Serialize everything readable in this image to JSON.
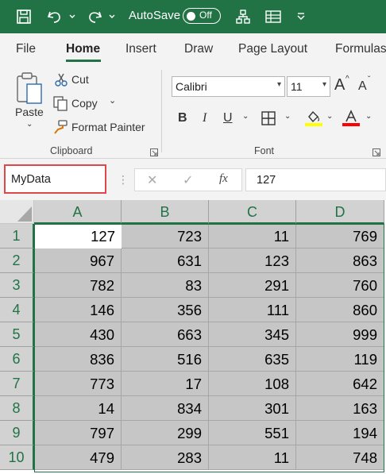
{
  "titlebar": {
    "autosave_label": "AutoSave",
    "autosave_state": "Off",
    "icons": [
      "save-icon",
      "undo-icon",
      "redo-icon",
      "hierarchy-icon",
      "form-icon",
      "customize-dropdown-icon"
    ]
  },
  "tabs": [
    {
      "label": "File"
    },
    {
      "label": "Home"
    },
    {
      "label": "Insert"
    },
    {
      "label": "Draw"
    },
    {
      "label": "Page Layout"
    },
    {
      "label": "Formulas"
    }
  ],
  "active_tab": "Home",
  "clipboard": {
    "paste_label": "Paste",
    "cut_label": "Cut",
    "copy_label": "Copy",
    "format_painter_label": "Format Painter",
    "group_label": "Clipboard"
  },
  "font": {
    "family": "Calibri",
    "size": "11",
    "grow_label": "A",
    "shrink_label": "A",
    "bold_label": "B",
    "italic_label": "I",
    "underline_label": "U",
    "group_label": "Font",
    "fill_color": "#ffff00",
    "font_color": "#ff0000"
  },
  "formula_bar": {
    "name_box": "MyData",
    "cancel_glyph": "✕",
    "enter_glyph": "✓",
    "fx_label": "fx",
    "value": "127"
  },
  "sheet": {
    "columns": [
      "A",
      "B",
      "C",
      "D"
    ],
    "rows": [
      {
        "num": "1",
        "cells": [
          "127",
          "723",
          "11",
          "769"
        ]
      },
      {
        "num": "2",
        "cells": [
          "967",
          "631",
          "123",
          "863"
        ]
      },
      {
        "num": "3",
        "cells": [
          "782",
          "83",
          "291",
          "760"
        ]
      },
      {
        "num": "4",
        "cells": [
          "146",
          "356",
          "111",
          "860"
        ]
      },
      {
        "num": "5",
        "cells": [
          "430",
          "663",
          "345",
          "999"
        ]
      },
      {
        "num": "6",
        "cells": [
          "836",
          "516",
          "635",
          "119"
        ]
      },
      {
        "num": "7",
        "cells": [
          "773",
          "17",
          "108",
          "642"
        ]
      },
      {
        "num": "8",
        "cells": [
          "14",
          "834",
          "301",
          "163"
        ]
      },
      {
        "num": "9",
        "cells": [
          "797",
          "299",
          "551",
          "194"
        ]
      },
      {
        "num": "10",
        "cells": [
          "479",
          "283",
          "11",
          "748"
        ]
      }
    ]
  },
  "colors": {
    "excel_green": "#217346",
    "name_box_highlight": "#e0464b",
    "selection_fill": "#c6c6c6"
  }
}
